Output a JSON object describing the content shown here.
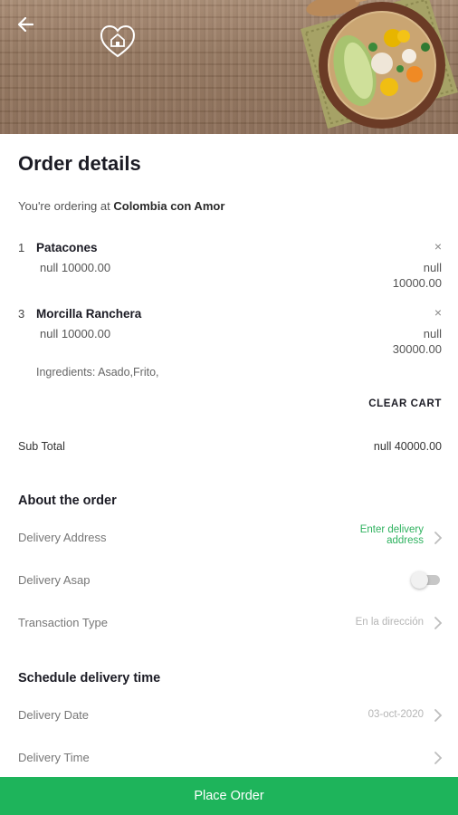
{
  "header": {
    "back_icon": "arrow-left-icon",
    "logo_icon": "heart-house-logo"
  },
  "order": {
    "title": "Order details",
    "ordering_prefix": "You're ordering at ",
    "restaurant": "Colombia con Amor",
    "items": [
      {
        "qty": "1",
        "name": "Patacones",
        "unit_price": "null 10000.00",
        "total_currency": "null",
        "total_amount": "10000.00",
        "remove": "×"
      },
      {
        "qty": "3",
        "name": "Morcilla Ranchera",
        "unit_price": "null 10000.00",
        "total_currency": "null",
        "total_amount": "30000.00",
        "remove": "×"
      }
    ],
    "ingredients": "Ingredients: Asado,Frito,",
    "clear_cart": "CLEAR CART",
    "subtotal_label": "Sub Total",
    "subtotal_value": "null 40000.00"
  },
  "about": {
    "title": "About the order",
    "delivery_address_label": "Delivery Address",
    "delivery_address_value_line1": "Enter delivery",
    "delivery_address_value_line2": "address",
    "delivery_asap_label": "Delivery Asap",
    "delivery_asap_on": false,
    "transaction_type_label": "Transaction Type",
    "transaction_type_value": "En la dirección"
  },
  "schedule": {
    "title": "Schedule delivery time",
    "delivery_date_label": "Delivery Date",
    "delivery_date_value": "03-oct-2020",
    "delivery_time_label": "Delivery Time"
  },
  "footer": {
    "place_order": "Place Order"
  },
  "colors": {
    "accent_green": "#1eb45b",
    "link_green": "#2fb25f"
  }
}
